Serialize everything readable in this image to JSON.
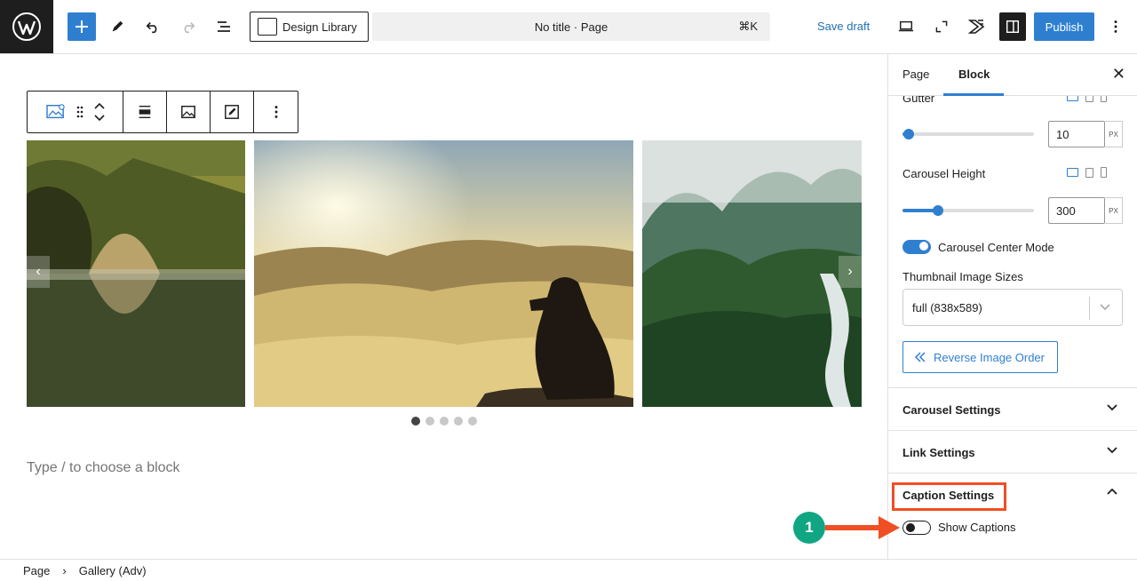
{
  "topbar": {
    "design_library_label": "Design Library",
    "document_title": "No title · Page",
    "shortcut": "⌘K",
    "save_draft_label": "Save draft",
    "publish_label": "Publish",
    "accent_color": "#2f7fd1"
  },
  "editor": {
    "placeholder": "Type / to choose a block",
    "carousel_dot_count": 5,
    "active_dot": 1
  },
  "sidebar": {
    "tabs": [
      {
        "label": "Page"
      },
      {
        "label": "Block"
      }
    ],
    "active_tab": "Block",
    "gutter": {
      "label": "Gutter",
      "value": "10",
      "unit": "PX",
      "fraction": 0.05
    },
    "carousel_height": {
      "label": "Carousel Height",
      "value": "300",
      "unit": "PX",
      "fraction": 0.27
    },
    "center_mode": {
      "label": "Carousel Center Mode",
      "enabled": true
    },
    "thumbnail_sizes": {
      "label": "Thumbnail Image Sizes",
      "selected": "full (838x589)"
    },
    "reverse_order_label": "Reverse Image Order",
    "panels": [
      {
        "title": "Carousel Settings",
        "expanded": false
      },
      {
        "title": "Link Settings",
        "expanded": false
      },
      {
        "title": "Caption Settings",
        "expanded": true
      }
    ],
    "show_captions": {
      "label": "Show Captions",
      "enabled": false
    }
  },
  "annotation": {
    "step_number": "1",
    "color": "#f04e23",
    "badge_color": "#11a683"
  },
  "breadcrumb": [
    "Page",
    "Gallery (Adv)"
  ]
}
